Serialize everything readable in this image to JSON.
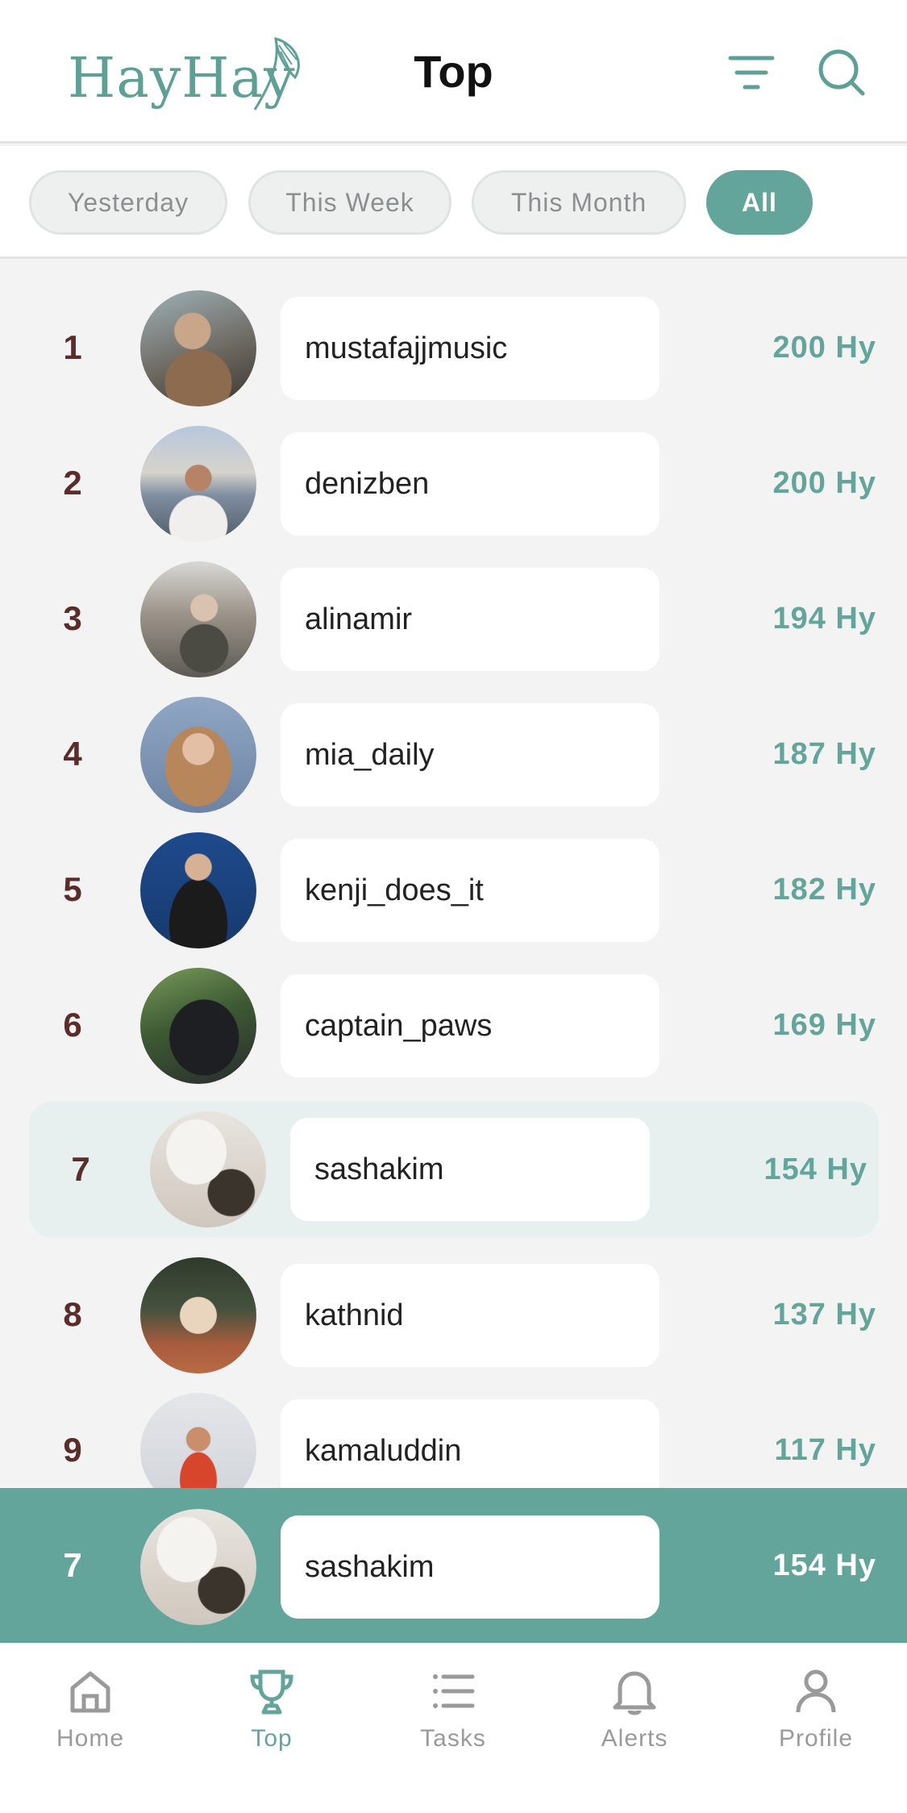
{
  "header": {
    "logo": "HayHay",
    "title": "Top",
    "icons": [
      "filter-icon",
      "search-icon"
    ]
  },
  "filters": [
    {
      "label": "Yesterday",
      "active": false
    },
    {
      "label": "This Week",
      "active": false
    },
    {
      "label": "This Month",
      "active": false
    },
    {
      "label": "All",
      "active": true
    }
  ],
  "leaderboard": [
    {
      "rank": "1",
      "username": "mustafajjmusic",
      "score": "200 Hy"
    },
    {
      "rank": "2",
      "username": "denizben",
      "score": "200 Hy"
    },
    {
      "rank": "3",
      "username": "alinamir",
      "score": "194 Hy"
    },
    {
      "rank": "4",
      "username": "mia_daily",
      "score": "187 Hy"
    },
    {
      "rank": "5",
      "username": "kenji_does_it",
      "score": "182 Hy"
    },
    {
      "rank": "6",
      "username": "captain_paws",
      "score": "169 Hy"
    },
    {
      "rank": "7",
      "username": "sashakim",
      "score": "154 Hy",
      "highlighted": true
    },
    {
      "rank": "8",
      "username": "kathnid",
      "score": "137 Hy"
    },
    {
      "rank": "9",
      "username": "kamaluddin",
      "score": "117 Hy"
    }
  ],
  "current_user": {
    "rank": "7",
    "username": "sashakim",
    "score": "154 Hy"
  },
  "nav": [
    {
      "label": "Home",
      "icon": "home-icon",
      "active": false
    },
    {
      "label": "Top",
      "icon": "trophy-icon",
      "active": true
    },
    {
      "label": "Tasks",
      "icon": "list-icon",
      "active": false
    },
    {
      "label": "Alerts",
      "icon": "bell-icon",
      "active": false
    },
    {
      "label": "Profile",
      "icon": "person-icon",
      "active": false
    }
  ],
  "colors": {
    "accent": "#63a59b",
    "rank_text": "#5a2d2a",
    "highlight_row": "#e7f0ef"
  }
}
